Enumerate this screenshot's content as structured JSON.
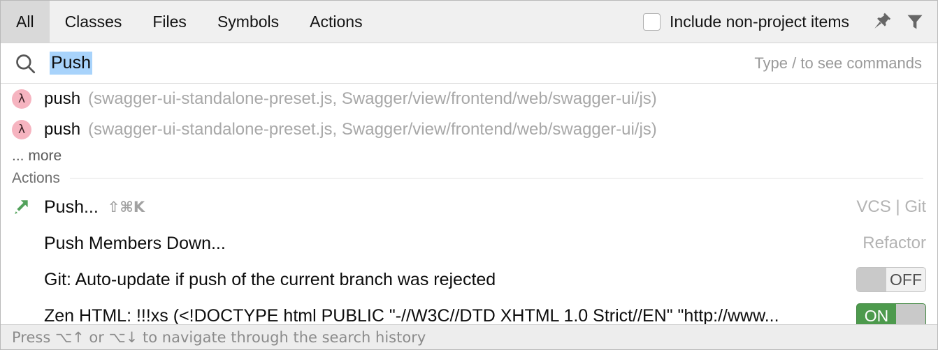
{
  "tabs": [
    {
      "label": "All",
      "selected": true
    },
    {
      "label": "Classes",
      "selected": false
    },
    {
      "label": "Files",
      "selected": false
    },
    {
      "label": "Symbols",
      "selected": false
    },
    {
      "label": "Actions",
      "selected": false
    }
  ],
  "header": {
    "include_non_project_label": "Include non-project items",
    "include_non_project_checked": false,
    "pin_icon": "pin-icon",
    "filter_icon": "filter-funnel-icon"
  },
  "search": {
    "icon": "search-icon",
    "value": "Push",
    "value_selected": true,
    "hint": "Type / to see commands"
  },
  "results": [
    {
      "icon": "lambda-icon",
      "glyph": "λ",
      "name": "push",
      "path": "(swagger-ui-standalone-preset.js, Swagger/view/frontend/web/swagger-ui/js)"
    },
    {
      "icon": "lambda-icon",
      "glyph": "λ",
      "name": "push",
      "path": "(swagger-ui-standalone-preset.js, Swagger/view/frontend/web/swagger-ui/js)"
    }
  ],
  "more_label": "... more",
  "actions_group_label": "Actions",
  "actions": [
    {
      "icon": "push-arrow-icon",
      "label": "Push...",
      "shortcut": "⇧⌘K",
      "group": "VCS | Git",
      "toggle": null
    },
    {
      "icon": null,
      "label": "Push Members Down...",
      "shortcut": "",
      "group": "Refactor",
      "toggle": null
    },
    {
      "icon": null,
      "label": "Git: Auto-update if push of the current branch was rejected",
      "shortcut": "",
      "group": "",
      "toggle": "OFF"
    },
    {
      "icon": null,
      "label": "Zen HTML: !!!xs (<!DOCTYPE html PUBLIC \"-//W3C//DTD XHTML 1.0 Strict//EN\" \"http://www...",
      "shortcut": "",
      "group": "",
      "toggle": "ON"
    }
  ],
  "footer": {
    "text": "Press ⌥↑ or ⌥↓ to navigate through the search history"
  },
  "colors": {
    "tab_selected_bg": "#d9d9d9",
    "header_bg": "#f0f0f0",
    "selection_blue": "#a8d3fb",
    "lambda_pink": "#f6b4c0",
    "push_green": "#53a25c",
    "toggle_on_green": "#4d9a4d",
    "muted_text": "#a8a8a8"
  }
}
